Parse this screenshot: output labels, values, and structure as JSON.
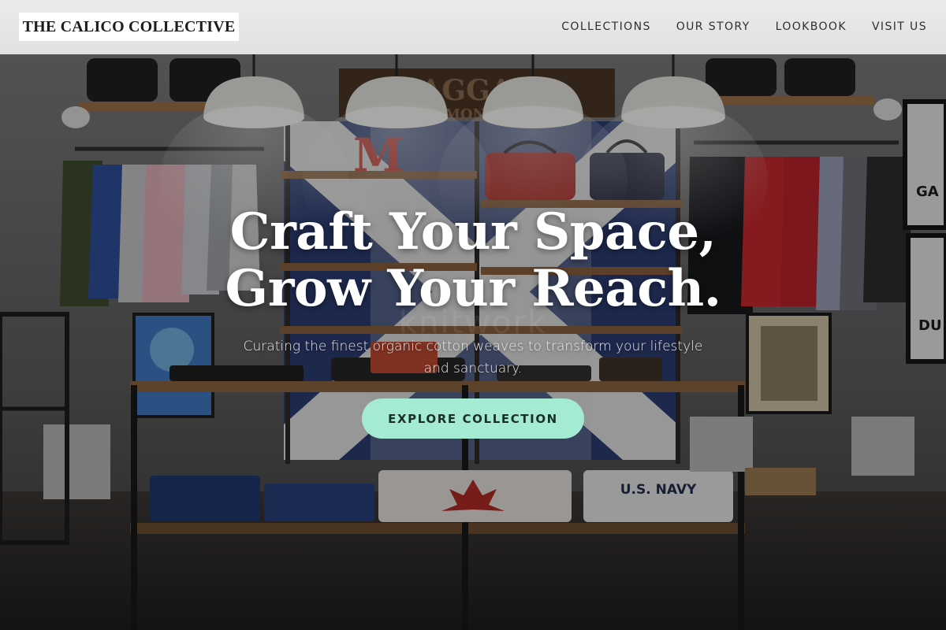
{
  "brand": {
    "name": "THE CALICO COLLECTIVE"
  },
  "nav": {
    "items": [
      {
        "label": "COLLECTIONS"
      },
      {
        "label": "OUR STORY"
      },
      {
        "label": "LOOKBOOK"
      },
      {
        "label": "VISIT US"
      }
    ]
  },
  "hero": {
    "headline_line1": "Craft Your Space,",
    "headline_line2": "Grow Your Reach.",
    "subtitle": "Curating the finest organic cotton weaves to transform your lifestyle and sanctuary.",
    "cta_label": "EXPLORE COLLECTION",
    "background_image": "boutique-store-interior",
    "watermark": "knitwork"
  },
  "scene": {
    "sign_text": "BAGGAGE",
    "sign_sub": "MON",
    "letter": "M",
    "shirt_text": "U.S. NAVY",
    "poster_text_1": "GA",
    "poster_text_2": "DU"
  },
  "colors": {
    "header_bg": "#e6e6e6",
    "cta_bg": "#a5ead2",
    "cta_text": "#18302a",
    "headline": "#ffffff"
  }
}
